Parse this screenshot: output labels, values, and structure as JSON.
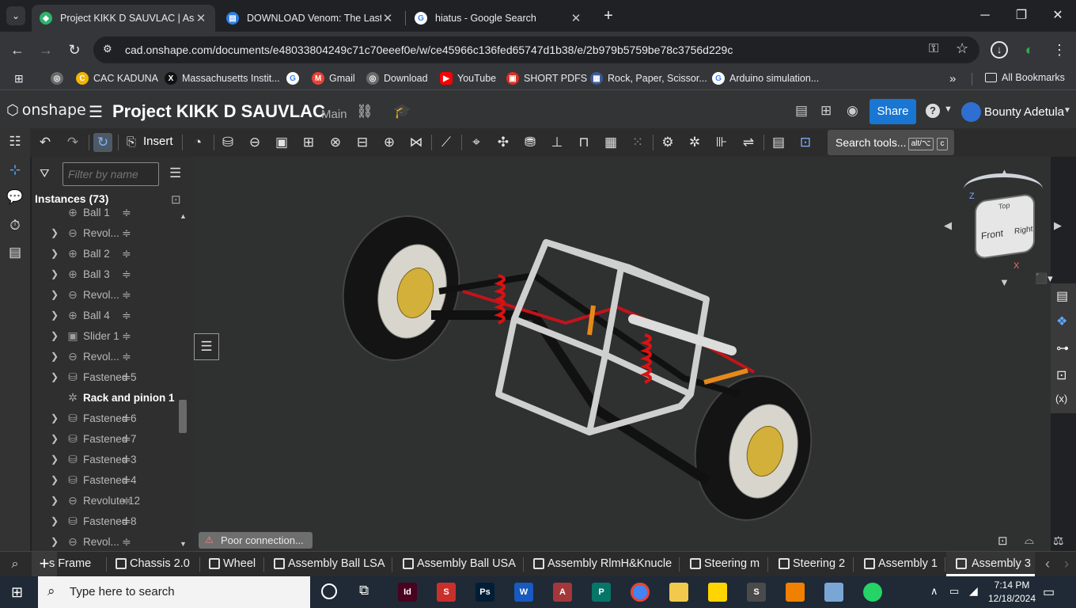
{
  "browser": {
    "tabs": [
      {
        "title": "Project KIKK D SAUVLAC | Assem",
        "favicon_color": "#2db36e",
        "active": true
      },
      {
        "title": "DOWNLOAD Venom: The Last D",
        "favicon_color": "#2f7de1",
        "active": false
      },
      {
        "title": "hiatus - Google Search",
        "favicon_color": "#ffffff",
        "active": false
      }
    ],
    "new_tab_glyph": "+",
    "url": "cad.onshape.com/documents/e48033804249c71c70eeef0e/w/ce45966c136fed65747d1b38/e/2b979b5759be78c3756d229c",
    "bookmarks": [
      {
        "label": "CAC KADUNA",
        "color": "#f4b400"
      },
      {
        "label": "Massachusetts Instit...",
        "color": "#111111"
      },
      {
        "label": "Gmail",
        "color": "#ea4335"
      },
      {
        "label": "Download",
        "color": "#6b6b6b"
      },
      {
        "label": "YouTube",
        "color": "#ff0000"
      },
      {
        "label": "SHORT PDFS",
        "color": "#d93025"
      },
      {
        "label": "Rock, Paper, Scissor...",
        "color": "#3c5a99"
      },
      {
        "label": "Arduino simulation...",
        "color": "#4285f4"
      }
    ],
    "all_bookmarks": "All Bookmarks",
    "overflow": "»"
  },
  "onshape": {
    "logo": "onshape",
    "document_name": "Project KIKK D SAUVLAC",
    "branch": "Main",
    "share": "Share",
    "user_name": "Bounty Adetula",
    "help": "?",
    "insert": "Insert",
    "search_tools": "Search tools...",
    "shortcut_a": "alt/⌥",
    "shortcut_b": "c"
  },
  "panel": {
    "filter_placeholder": "Filter by name",
    "instances_title": "Instances (73)",
    "rows": [
      {
        "label": "Ball 1",
        "icon": "ball-mate-icon",
        "glyph": "⊕",
        "expand": false,
        "strong": false
      },
      {
        "label": "Revol...",
        "icon": "revolute-mate-icon",
        "glyph": "⊖",
        "expand": true,
        "strong": false
      },
      {
        "label": "Ball 2",
        "icon": "ball-mate-icon",
        "glyph": "⊕",
        "expand": true,
        "strong": false
      },
      {
        "label": "Ball 3",
        "icon": "ball-mate-icon",
        "glyph": "⊕",
        "expand": true,
        "strong": false
      },
      {
        "label": "Revol...",
        "icon": "revolute-mate-icon",
        "glyph": "⊖",
        "expand": true,
        "strong": false
      },
      {
        "label": "Ball 4",
        "icon": "ball-mate-icon",
        "glyph": "⊕",
        "expand": true,
        "strong": false
      },
      {
        "label": "Slider 1",
        "icon": "slider-mate-icon",
        "glyph": "▣",
        "expand": true,
        "strong": false
      },
      {
        "label": "Revol...",
        "icon": "revolute-mate-icon",
        "glyph": "⊖",
        "expand": true,
        "strong": false
      },
      {
        "label": "Fastened 5",
        "icon": "fastened-mate-icon",
        "glyph": "⛁",
        "expand": true,
        "strong": false
      },
      {
        "label": "Rack and pinion 1",
        "icon": "rack-pinion-icon",
        "glyph": "✲",
        "expand": false,
        "strong": true
      },
      {
        "label": "Fastened 6",
        "icon": "fastened-mate-icon",
        "glyph": "⛁",
        "expand": true,
        "strong": false
      },
      {
        "label": "Fastened 7",
        "icon": "fastened-mate-icon",
        "glyph": "⛁",
        "expand": true,
        "strong": false
      },
      {
        "label": "Fastened 3",
        "icon": "fastened-mate-icon",
        "glyph": "⛁",
        "expand": true,
        "strong": false
      },
      {
        "label": "Fastened 4",
        "icon": "fastened-mate-icon",
        "glyph": "⛁",
        "expand": true,
        "strong": false
      },
      {
        "label": "Revolute 12",
        "icon": "revolute-mate-icon",
        "glyph": "⊖",
        "expand": true,
        "strong": false
      },
      {
        "label": "Fastened 8",
        "icon": "fastened-mate-icon",
        "glyph": "⛁",
        "expand": true,
        "strong": false
      },
      {
        "label": "Revol...",
        "icon": "revolute-mate-icon",
        "glyph": "⊖",
        "expand": true,
        "strong": false
      }
    ]
  },
  "viewport": {
    "status": "Poor connection...",
    "view_cube": {
      "top": "Top",
      "front": "Front",
      "right": "Right",
      "z": "Z",
      "x": "X"
    }
  },
  "bottom_tabs": [
    {
      "label": "s Frame",
      "active": false
    },
    {
      "label": "Chassis 2.0",
      "active": false
    },
    {
      "label": "Wheel",
      "active": false
    },
    {
      "label": "Assembly Ball LSA",
      "active": false
    },
    {
      "label": "Assembly Ball USA",
      "active": false
    },
    {
      "label": "Assembly RlmH&Knucle",
      "active": false
    },
    {
      "label": "Steering m",
      "active": false
    },
    {
      "label": "Steering 2",
      "active": false
    },
    {
      "label": "Assembly 1",
      "active": false
    },
    {
      "label": "Assembly 3",
      "active": true
    }
  ],
  "taskbar": {
    "search_placeholder": "Type here to search",
    "time": "7:14 PM",
    "date": "12/18/2024",
    "apps": [
      {
        "name": "indesign",
        "label": "Id",
        "color": "#49021f"
      },
      {
        "name": "sketchup",
        "label": "S",
        "color": "#c9302c"
      },
      {
        "name": "photoshop",
        "label": "Ps",
        "color": "#001e36"
      },
      {
        "name": "word",
        "label": "W",
        "color": "#185abd"
      },
      {
        "name": "access",
        "label": "A",
        "color": "#a4373a"
      },
      {
        "name": "publisher",
        "label": "P",
        "color": "#077568"
      },
      {
        "name": "chrome",
        "label": "",
        "color": "#4285f4"
      },
      {
        "name": "file-explorer",
        "label": "",
        "color": "#f2c94c"
      },
      {
        "name": "sticky-notes",
        "label": "",
        "color": "#ffd400"
      },
      {
        "name": "sublime",
        "label": "S",
        "color": "#4a4a4a"
      },
      {
        "name": "vlc",
        "label": "",
        "color": "#f08000"
      },
      {
        "name": "image-viewer",
        "label": "",
        "color": "#7aa6d6"
      },
      {
        "name": "whatsapp",
        "label": "",
        "color": "#25d366"
      }
    ]
  }
}
